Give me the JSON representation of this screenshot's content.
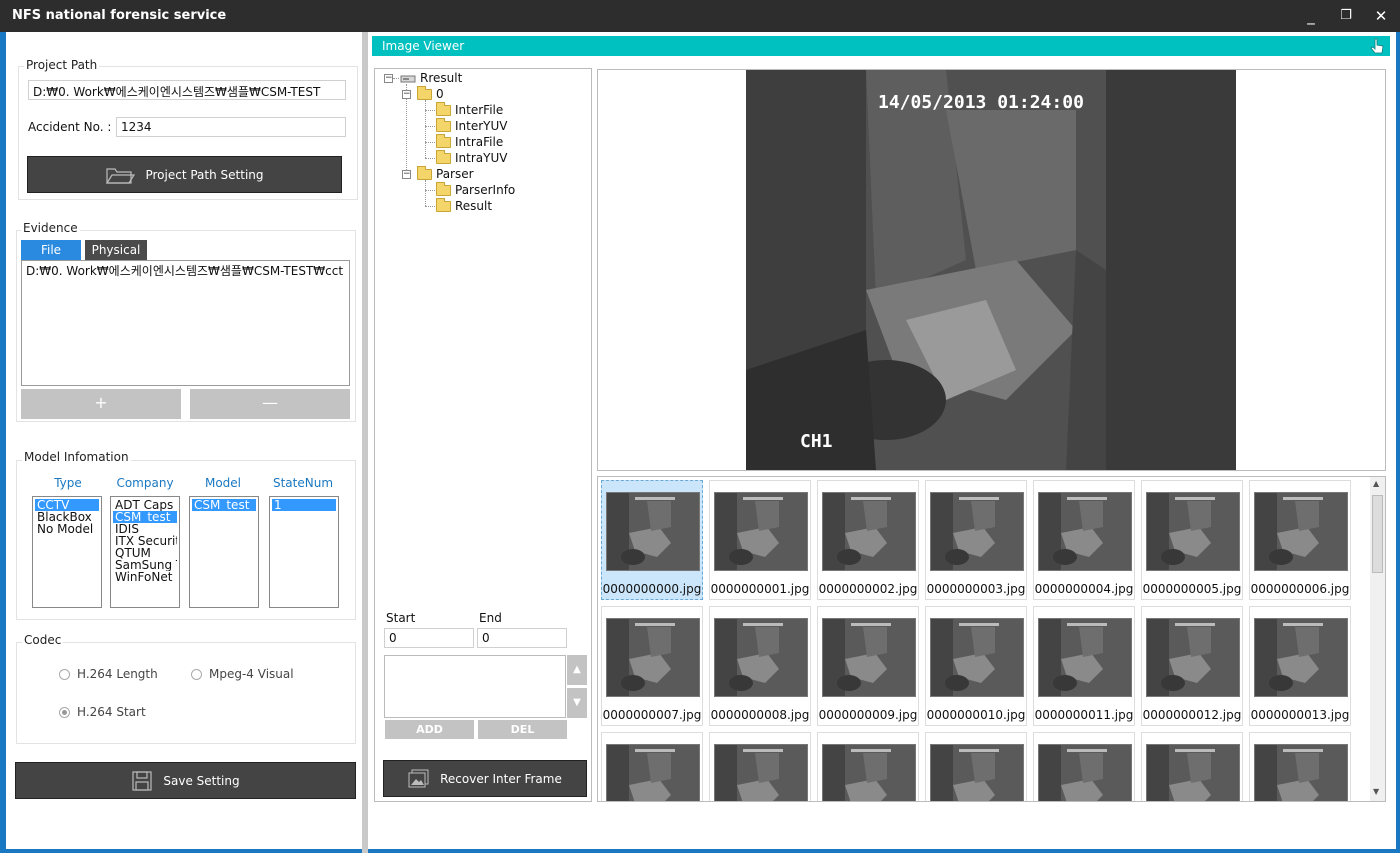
{
  "window": {
    "title": "NFS national forensic service",
    "minimize": "_",
    "restore": "❐",
    "close": "✕"
  },
  "project": {
    "group_label": "Project Path",
    "path_value": "D:₩0. Work₩에스케이엔시스템즈₩샘플₩CSM-TEST",
    "accident_label": "Accident No. :",
    "accident_value": "1234",
    "setting_button": "Project Path Setting"
  },
  "evidence": {
    "group_label": "Evidence",
    "tabs": [
      "File",
      "Physical"
    ],
    "items": [
      "D:₩0. Work₩에스케이엔시스템즈₩샘플₩CSM-TEST₩cct"
    ],
    "add": "+",
    "remove": "—"
  },
  "model": {
    "group_label": "Model Infomation",
    "headers": [
      "Type",
      "Company",
      "Model",
      "StateNum"
    ],
    "types": [
      "CCTV",
      "BlackBox",
      "No Model"
    ],
    "companies": [
      "ADT Caps",
      "CSM_test",
      "IDIS",
      "ITX Security",
      "QTUM",
      "SamSung T",
      "WinFoNet"
    ],
    "models": [
      "CSM_test"
    ],
    "statenums": [
      "1"
    ]
  },
  "codec": {
    "group_label": "Codec",
    "options": [
      "H.264 Length",
      "Mpeg-4 Visual",
      "H.264 Start"
    ],
    "checked": "H.264 Start"
  },
  "save_button": "Save Setting",
  "viewer": {
    "title": "Image Viewer",
    "osd_timestamp": "14/05/2013 01:24:00",
    "osd_channel": "CH1"
  },
  "tree": {
    "root": "Rresult",
    "nodes": [
      "0",
      "InterFile",
      "InterYUV",
      "IntraFile",
      "IntraYUV",
      "Parser",
      "ParserInfo",
      "Result"
    ]
  },
  "range": {
    "start_label": "Start",
    "end_label": "End",
    "start_value": "0",
    "end_value": "0",
    "add": "ADD",
    "del": "DEL",
    "recover_button": "Recover Inter Frame"
  },
  "thumbnails": [
    "0000000000.jpg",
    "0000000001.jpg",
    "0000000002.jpg",
    "0000000003.jpg",
    "0000000004.jpg",
    "0000000005.jpg",
    "0000000006.jpg",
    "0000000007.jpg",
    "0000000008.jpg",
    "0000000009.jpg",
    "0000000010.jpg",
    "0000000011.jpg",
    "0000000012.jpg",
    "0000000013.jpg",
    "",
    "",
    "",
    "",
    "",
    "",
    ""
  ],
  "colors": {
    "accent_blue": "#1a78c2",
    "viewer_bar": "#00c0c0",
    "selection": "#3399ff",
    "dark_button": "#444444"
  }
}
